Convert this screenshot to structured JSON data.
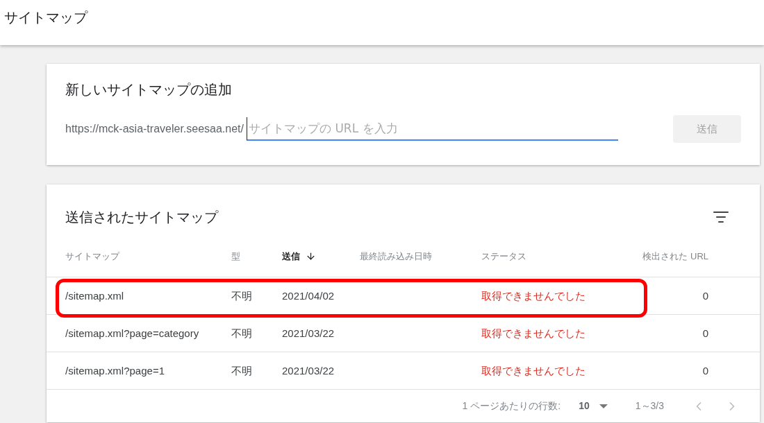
{
  "page_title": "サイトマップ",
  "add_card": {
    "title": "新しいサイトマップの追加",
    "url_prefix": "https://mck-asia-traveler.seesaa.net/",
    "placeholder": "サイトマップの URL を入力",
    "submit": "送信"
  },
  "submitted_card": {
    "title": "送信されたサイトマップ",
    "columns": [
      {
        "label": "サイトマップ",
        "sorted": false
      },
      {
        "label": "型",
        "sorted": false
      },
      {
        "label": "送信",
        "sorted": true
      },
      {
        "label": "最終読み込み日時",
        "sorted": false
      },
      {
        "label": "ステータス",
        "sorted": false
      },
      {
        "label": "検出された URL",
        "sorted": false
      }
    ],
    "rows": [
      {
        "sitemap": "/sitemap.xml",
        "type": "不明",
        "submitted": "2021/04/02",
        "status": "取得できませんでした",
        "urls": "0",
        "highlighted": true
      },
      {
        "sitemap": "/sitemap.xml?page=category",
        "type": "不明",
        "submitted": "2021/03/22",
        "status": "取得できませんでした",
        "urls": "0",
        "highlighted": false
      },
      {
        "sitemap": "/sitemap.xml?page=1",
        "type": "不明",
        "submitted": "2021/03/22",
        "status": "取得できませんでした",
        "urls": "0",
        "highlighted": false
      }
    ],
    "pagination": {
      "rows_label": "1 ページあたりの行数:",
      "rows_value": "10",
      "range": "1～3/3"
    }
  }
}
